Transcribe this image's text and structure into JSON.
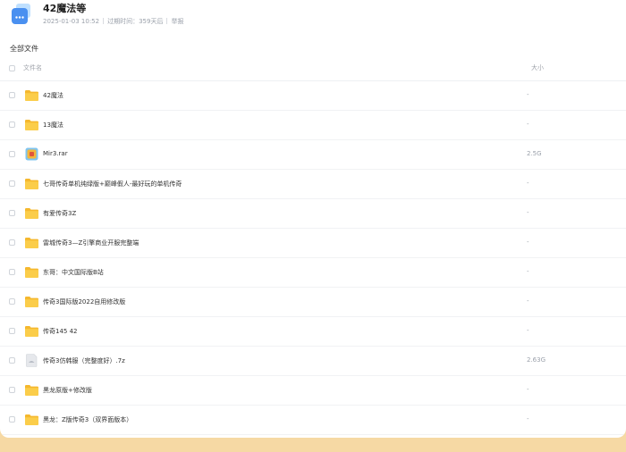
{
  "share": {
    "title": "42魔法等",
    "date": "2025-01-03 10:52",
    "expire": "过期时间：359天后",
    "report": "举报",
    "icon": "share-folder-icon"
  },
  "breadcrumb": {
    "root": "全部文件"
  },
  "table": {
    "col_name": "文件名",
    "col_size": "大小"
  },
  "files": [
    {
      "name": "42魔法",
      "size": "-",
      "icon": "folder-icon"
    },
    {
      "name": "13魔法",
      "size": "-",
      "icon": "folder-icon"
    },
    {
      "name": "Mir3.rar",
      "size": "2.5G",
      "icon": "archive-icon"
    },
    {
      "name": "七哥传奇单机纯绿版+巅峰假人-最好玩的单机传奇",
      "size": "-",
      "icon": "folder-icon"
    },
    {
      "name": "有爱传奇3Z",
      "size": "-",
      "icon": "folder-icon"
    },
    {
      "name": "雷城传奇3—Z引擎商业开服完整端",
      "size": "-",
      "icon": "folder-icon"
    },
    {
      "name": "东哥：中文国际版B站",
      "size": "-",
      "icon": "folder-icon"
    },
    {
      "name": "传奇3国际版2022自用修改版",
      "size": "-",
      "icon": "folder-icon"
    },
    {
      "name": "传奇145 42",
      "size": "-",
      "icon": "folder-icon"
    },
    {
      "name": "传奇3仿韩服（完整度好）.7z",
      "size": "2.63G",
      "icon": "file-icon"
    },
    {
      "name": "黑龙原版+修改版",
      "size": "-",
      "icon": "folder-icon"
    },
    {
      "name": "黑龙：Z版传奇3（双界面版本）",
      "size": "-",
      "icon": "folder-icon"
    }
  ],
  "colors": {
    "folder": "#f7c23e",
    "accent": "#4a90f0",
    "footer": "#f6d9a4"
  }
}
